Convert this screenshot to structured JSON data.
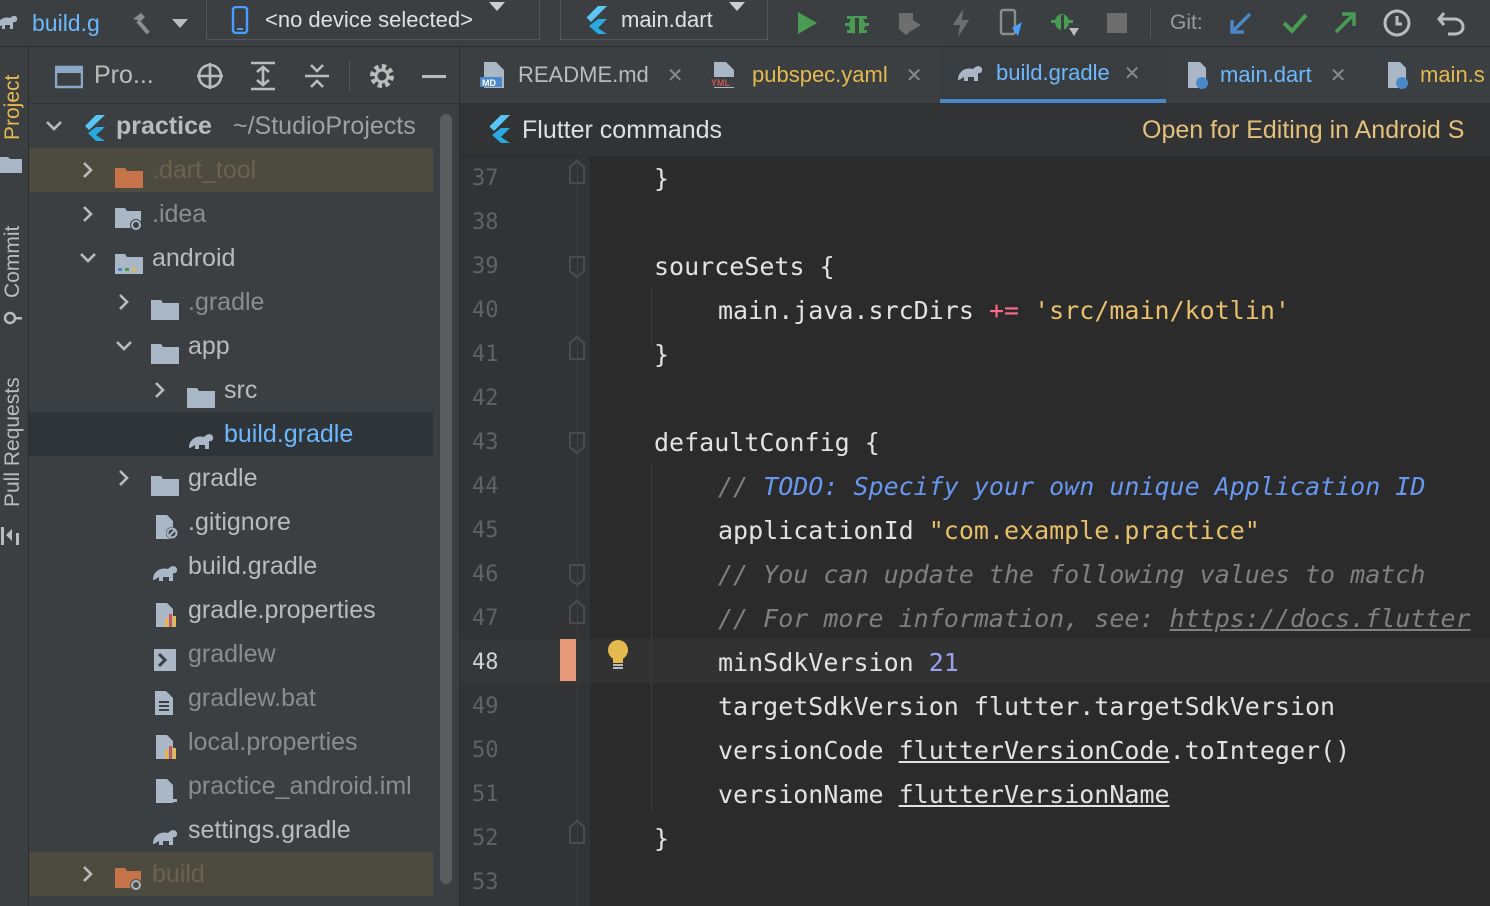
{
  "toolbar": {
    "file_crumb": "build.g",
    "device_selector": "<no device selected>",
    "run_config": "main.dart",
    "git_label": "Git:"
  },
  "side_strip": {
    "project": "Project",
    "commit": "Commit",
    "pull_requests": "Pull Requests"
  },
  "project_panel": {
    "title": "Pro...",
    "tree": [
      {
        "label": "practice",
        "suffix": "~/StudioProjects",
        "state": "expanded",
        "icon": "flutter-icon"
      },
      {
        "label": ".dart_tool",
        "state": "collapsed",
        "icon": "folder-excluded-icon"
      },
      {
        "label": ".idea",
        "state": "collapsed",
        "icon": "folder-settings-icon"
      },
      {
        "label": "android",
        "state": "expanded",
        "icon": "android-module-folder-icon"
      },
      {
        "label": ".gradle",
        "state": "collapsed",
        "icon": "folder-icon"
      },
      {
        "label": "app",
        "state": "expanded",
        "icon": "folder-icon"
      },
      {
        "label": "src",
        "state": "collapsed",
        "icon": "folder-icon"
      },
      {
        "label": "build.gradle",
        "state": "selected",
        "icon": "gradle-icon"
      },
      {
        "label": "gradle",
        "state": "collapsed",
        "icon": "folder-icon"
      },
      {
        "label": ".gitignore",
        "icon": "ignore-file-icon"
      },
      {
        "label": "build.gradle",
        "icon": "gradle-icon"
      },
      {
        "label": "gradle.properties",
        "icon": "properties-file-icon"
      },
      {
        "label": "gradlew",
        "icon": "shell-script-icon"
      },
      {
        "label": "gradlew.bat",
        "icon": "text-file-icon"
      },
      {
        "label": "local.properties",
        "icon": "properties-file-icon"
      },
      {
        "label": "practice_android.iml",
        "icon": "iml-file-icon"
      },
      {
        "label": "settings.gradle",
        "icon": "gradle-icon"
      },
      {
        "label": "build",
        "state": "collapsed",
        "icon": "folder-excluded-icon"
      }
    ]
  },
  "editor_tabs": [
    {
      "label": "README.md",
      "icon": "markdown-icon"
    },
    {
      "label": "pubspec.yaml",
      "icon": "yaml-icon"
    },
    {
      "label": "build.gradle",
      "icon": "gradle-icon",
      "active": true
    },
    {
      "label": "main.dart",
      "icon": "dart-icon"
    },
    {
      "label": "main.s",
      "icon": "dart-icon"
    }
  ],
  "banner": {
    "title": "Flutter commands",
    "action": "Open for Editing in Android S"
  },
  "editor": {
    "current_line": 48,
    "line_numbers": [
      "37",
      "38",
      "39",
      "40",
      "41",
      "42",
      "43",
      "44",
      "45",
      "46",
      "47",
      "48",
      "49",
      "50",
      "51",
      "52",
      "53"
    ],
    "lines": {
      "l37": "}",
      "l39a": "sourceSets",
      "l39b": " {",
      "l40a": "main.java.srcDirs ",
      "l40b": "+=",
      "l40c": " ",
      "l40d": "'src/main/kotlin'",
      "l41": "}",
      "l43a": "defaultConfig",
      "l43b": " {",
      "l44a": "// ",
      "l44b": "TODO: Specify your own unique Application ID",
      "l45a": "applicationId ",
      "l45b": "\"com.example.practice\"",
      "l46": "// You can update the following values to match",
      "l47a": "// For more information, see: ",
      "l47b": "https://docs.flutter",
      "l48a": "minSdkVersion ",
      "l48b": "21",
      "l49": "targetSdkVersion flutter.targetSdkVersion",
      "l50a": "versionCode ",
      "l50b": "flutterVersionCode",
      "l50c": ".toInteger()",
      "l51a": "versionName ",
      "l51b": "flutterVersionName",
      "l52": "}"
    }
  },
  "colors": {
    "accent_blue": "#4a88c7",
    "selected_tab_text": "#6cb8ff",
    "banner_action": "#e5c07b",
    "change_marker": "#e8997a"
  }
}
